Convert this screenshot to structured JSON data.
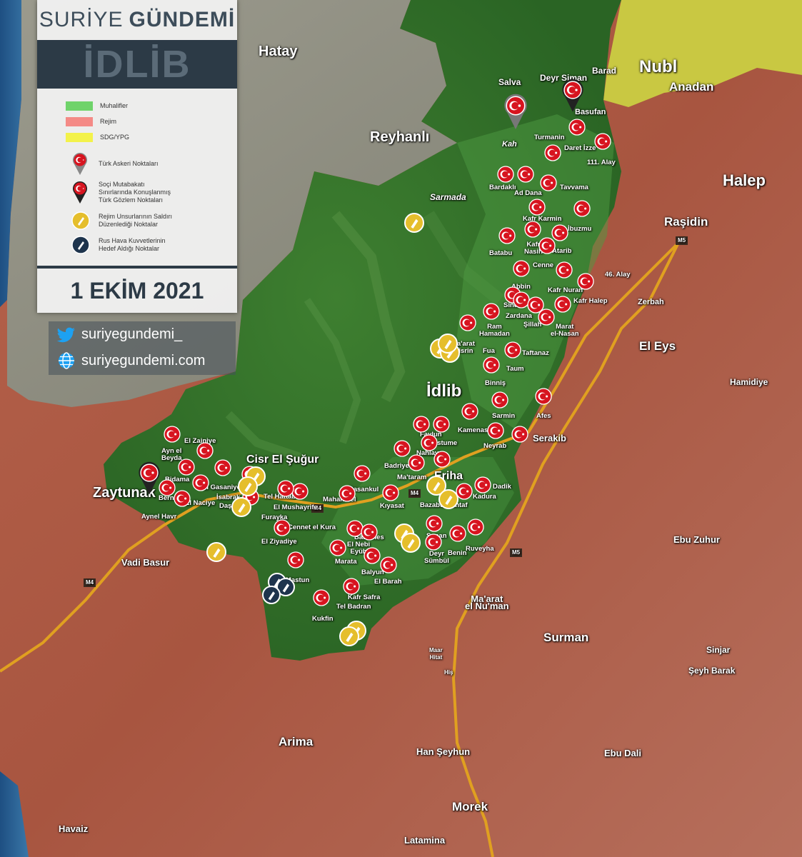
{
  "brand": {
    "part1": "SURİYE",
    "part2": "GÜNDEMİ"
  },
  "region_title": "İDLİB",
  "legend": {
    "opposition": "Muhalifler",
    "regime": "Rejim",
    "sdg": "SDG/YPG",
    "turkish_posts": "Türk Askeri Noktaları",
    "sochi_posts_line1": "Soçi Mutabakatı",
    "sochi_posts_line2": "Sınırlarında Konuşlanmış",
    "sochi_posts_line3": "Türk Gözlem Noktaları",
    "regime_attack_line1": "Rejim Unsurlarının Saldırı",
    "regime_attack_line2": "Düzenlediği Noktalar",
    "russian_air_line1": "Rus Hava Kuvvetlerinin",
    "russian_air_line2": "Hedef Aldığı Noktalar"
  },
  "date": "1 EKİM 2021",
  "social": {
    "twitter": "suriyegundemi_",
    "website": "suriyegundemi.com"
  },
  "colors": {
    "opposition": "#6fd36a",
    "regime": "#f48a86",
    "sdg": "#f3f24a",
    "panel_dark": "#2c3a46",
    "marker_red": "#d7141f",
    "marker_yellow": "#e5be2c",
    "marker_navy": "#1e344d"
  },
  "labels": {
    "hatay": "Hatay",
    "reyhanli": "Reyhanlı",
    "nubl": "Nubl",
    "anadan": "Anadan",
    "halep": "Halep",
    "rasidin": "Raşidin",
    "zerbah": "Zerbah",
    "el_eys": "El Eys",
    "hamidiye": "Hamidiye",
    "idlib": "İdlib",
    "cisr": "Cisr El Şuğur",
    "zaytunak": "Zaytunak",
    "serakib": "Serakib",
    "vadi_basur": "Vadi Basur",
    "ebu_zuhur": "Ebu Zuhur",
    "maarat_numan_1": "Ma'arat",
    "maarat_numan_2": "el Nu'man",
    "surman": "Surman",
    "sinjar": "Sinjar",
    "seyh_barak": "Şeyh Barak",
    "arima": "Arima",
    "han_seyhun": "Han Şeyhun",
    "ebu_dali": "Ebu Dali",
    "morek": "Morek",
    "havaiz": "Havaiz",
    "latamina": "Latamina",
    "salva": "Salva",
    "deyr_siman": "Deyr Siman",
    "barad": "Barad",
    "basufan": "Basufan",
    "kah": "Kah",
    "sarmada": "Sarmada",
    "turmanin": "Turmanin",
    "daret_izze": "Daret İzze",
    "alay_111": "111. Alay",
    "bardakli": "Bardaklı",
    "ad_dana": "Ad Dana",
    "tavvama": "Tavvama",
    "kafr_karmin": "Kafr Karmin",
    "ibuzmu": "İbuzmu",
    "batabu": "Batabu",
    "kafr_nasih_1": "Kafr",
    "kafr_nasih_2": "Nasih",
    "atarib": "Atarib",
    "cenne": "Cenne",
    "alay_46": "46. Alay",
    "abbin": "Abbin",
    "kafr_nuran": "Kafr Nuran",
    "tel_sindal_1": "Tel",
    "tel_sindal_2": "Sindal",
    "kafr_halep": "Kafr Halep",
    "zardana": "Zardana",
    "sillah": "Şillah",
    "ram_hamadan_1": "Ram",
    "ram_hamadan_2": "Hamadan",
    "marat_nasan_1": "Marat",
    "marat_nasan_2": "el-Nasan",
    "maarat_misrin_1": "Ma'arat",
    "maarat_misrin_2": "Misrin",
    "fua": "Fua",
    "taftanaz": "Taftanaz",
    "taum": "Taum",
    "binnis": "Binniş",
    "sarmin": "Sarmin",
    "afes": "Afes",
    "faylun": "Faylun",
    "kamenas": "Kamenas",
    "mastume": "Mastume",
    "neyrab": "Neyrab",
    "nahlaya": "Nahlaya",
    "badriye": "Badriye",
    "maataram": "Ma'taram",
    "eriha": "Eriha",
    "dadik": "Dadik",
    "kadura": "Kadura",
    "basankul": "Basankul",
    "kiyasat": "Kıyasat",
    "bazabur": "Bazabur",
    "mantaf": "Mantaf",
    "el_zainiye": "El Zainiye",
    "ayn_el_beyda_1": "Ayn el",
    "ayn_el_beyda_2": "Beyda",
    "bidama": "Bidama",
    "el_gasaniye": "El Gasaniye",
    "bernis": "Bernis",
    "el_naciye": "El Naciye",
    "ayn_el_havr": "Aynel Havr",
    "isabrak": "İsabrak",
    "dasi": "Daşi",
    "tel_hattab": "Tel Hattab",
    "el_mushayrife": "El Mushayrife",
    "mahambel": "Mahambel",
    "furayka": "Furayka",
    "cennet_el_kura": "Cennet el Kura",
    "el_ziyadiye": "El Ziyadiye",
    "basames": "Basames",
    "el_nebi_eyub_1": "El Nebi",
    "el_nebi_eyub_2": "Eyüb",
    "sanan": "Şanan",
    "benin": "Benin",
    "ruveyha": "Ruveyha",
    "deyr_sumbul_1": "Deyr",
    "deyr_sumbul_2": "Sümbül",
    "marata": "Marata",
    "balyun": "Balyun",
    "el_barah": "El Barah",
    "kafr_safra": "Kafr Safra",
    "tel_badran": "Tel Badran",
    "kukfin": "Kukfin",
    "mastun": "Mastun",
    "m4_a": "M4",
    "m4_b": "M4",
    "m4_c": "M4",
    "m5_a": "M5",
    "m5_b": "M5",
    "maar_hitat_1": "Maar",
    "maar_hitat_2": "Hitat",
    "his": "Hiş"
  }
}
